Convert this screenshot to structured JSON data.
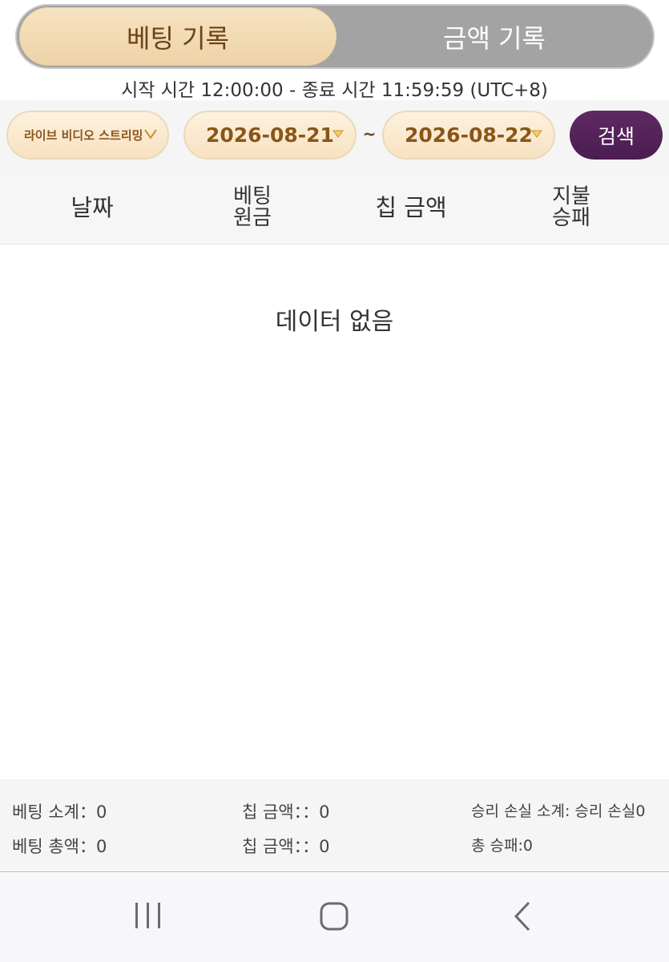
{
  "tabs": [
    {
      "label": "베팅 기록",
      "active": true
    },
    {
      "label": "금액 기록",
      "active": false
    }
  ],
  "time_note": "시작 시간 12:00:00 - 종료 시간 11:59:59 (UTC+8)",
  "filters": {
    "mode": "라이브 비디오 스트리밍",
    "start_date": "2026-08-21",
    "separator": "~",
    "end_date": "2026-08-22",
    "search_label": "검색"
  },
  "table": {
    "headers": [
      {
        "line1": "날짜",
        "line2": ""
      },
      {
        "line1": "베팅",
        "line2": "원금"
      },
      {
        "line1": "칩 금액",
        "line2": ""
      },
      {
        "line1": "지불",
        "line2": "승패"
      }
    ],
    "empty_text": "데이터 없음"
  },
  "summary": {
    "bet_subtotal": "베팅 소계：0",
    "chip_amount_1": "칩 금액：：0",
    "win_loss_subtotal": "승리 손실 소계: 승리 손실0",
    "bet_total": "베팅 총액：0",
    "chip_amount_2": "칩 금액：：0",
    "total_win_loss": "총 승패:0"
  },
  "navbar": {
    "icons": [
      "recent-apps-icon",
      "home-icon",
      "back-icon"
    ]
  },
  "colors": {
    "active_tab": "#edd2a6",
    "inactive_bg": "#a3a3a3",
    "pill_text": "#8a5618",
    "search_button": "#4a1c50"
  }
}
